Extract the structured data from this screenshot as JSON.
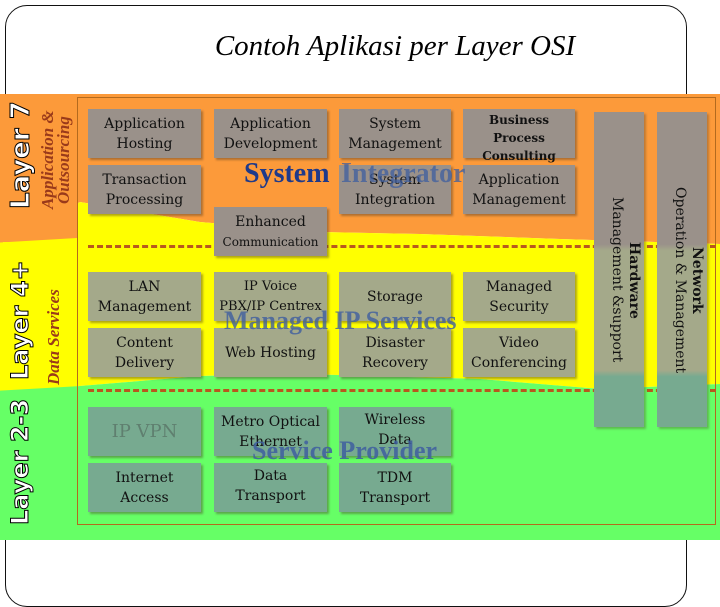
{
  "title": "Contoh Aplikasi per Layer OSI",
  "colors": {
    "layer7_band": "#fc9a3a",
    "layer4_band": "#ffff00",
    "layer23_band": "#66ff66",
    "box_gray": "#9a918a",
    "overlay_text": "#1f3a8a",
    "dash": "#b8581e"
  },
  "layers": [
    {
      "label": "Layer 7",
      "sublabel": "Application & Outsourcing",
      "sub_line1": "Application &",
      "sub_line2": "Outsourcing"
    },
    {
      "label": "Layer 4+",
      "sublabel": "Data Services"
    },
    {
      "label": "Layer 2-3",
      "sublabel": ""
    }
  ],
  "overlays": {
    "system_integrator_1": "System",
    "system_integrator_2": "Integrator",
    "managed_ip": "Managed IP Services",
    "service_provider": "Service Provider"
  },
  "boxes": {
    "app_hosting": [
      "Application",
      "Hosting"
    ],
    "app_development": [
      "Application",
      "Development"
    ],
    "system_management": [
      "System",
      "Management"
    ],
    "business_process": [
      "Business Process",
      "Consulting"
    ],
    "transaction_processing": [
      "Transaction",
      "Processing"
    ],
    "system_integration": [
      "System",
      "Integration"
    ],
    "app_management": [
      "Application",
      "Management"
    ],
    "enhanced_comm": [
      "Enhanced",
      "Communication"
    ],
    "lan_management": [
      "LAN",
      "Management"
    ],
    "ip_voice": [
      "IP Voice",
      "PBX/IP Centrex"
    ],
    "storage": [
      "Storage"
    ],
    "managed_security": [
      "Managed",
      "Security"
    ],
    "content_delivery": [
      "Content",
      "Delivery"
    ],
    "web_hosting": [
      "Web Hosting"
    ],
    "disaster_recovery": [
      "Disaster",
      "Recovery"
    ],
    "video_conferencing": [
      "Video",
      "Conferencing"
    ],
    "ip_vpn": [
      "IP VPN"
    ],
    "metro_optical": [
      "Metro Optical",
      "Ethernet"
    ],
    "wireless_data": [
      "Wireless",
      "Data"
    ],
    "internet_access": [
      "Internet",
      "Access"
    ],
    "data_transport": [
      "Data",
      "Transport"
    ],
    "tdm_transport": [
      "TDM",
      "Transport"
    ]
  },
  "vertical_boxes": {
    "hardware": {
      "line1": "Hardware",
      "line2": "Management &support"
    },
    "network": {
      "line1": "Network",
      "line2": "Operation & Management"
    }
  }
}
